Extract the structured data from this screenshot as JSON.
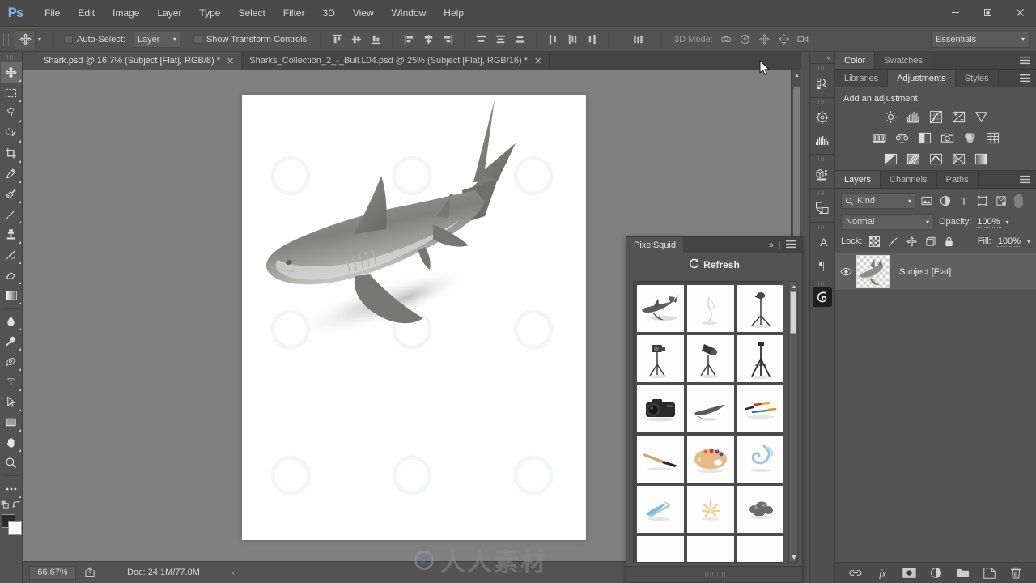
{
  "app": {
    "name": "Adobe Photoshop",
    "logo": "Ps",
    "logo_color": "#7fb3e8"
  },
  "titlebar": {
    "menus": [
      "File",
      "Edit",
      "Image",
      "Layer",
      "Type",
      "Select",
      "Filter",
      "3D",
      "View",
      "Window",
      "Help"
    ],
    "window_controls": [
      {
        "name": "minimize-button",
        "glyph": "—"
      },
      {
        "name": "maximize-button",
        "glyph": "❐"
      },
      {
        "name": "close-button",
        "glyph": "✕"
      }
    ]
  },
  "options_bar": {
    "tool_icon": "move-tool-icon",
    "auto_select_label": "Auto-Select:",
    "auto_select_checked": false,
    "auto_select_target": "Layer",
    "show_transform_label": "Show Transform Controls",
    "show_transform_checked": false,
    "align_icons": [
      "align-top-edges-icon",
      "align-vertical-centers-icon",
      "align-bottom-edges-icon",
      "align-left-edges-icon",
      "align-horizontal-centers-icon",
      "align-right-edges-icon"
    ],
    "distribute_icons": [
      "distribute-top-edges-icon",
      "distribute-vertical-centers-icon",
      "distribute-bottom-edges-icon",
      "distribute-left-edges-icon",
      "distribute-horizontal-centers-icon",
      "distribute-right-edges-icon"
    ],
    "auto_align_icon": "auto-align-layers-icon",
    "mode_3d_label": "3D Mode:",
    "mode_3d_icons": [
      "rotate-3d-object-icon",
      "roll-3d-object-icon",
      "drag-3d-object-icon",
      "slide-3d-object-icon",
      "scale-3d-object-icon"
    ],
    "workspace": "Essentials"
  },
  "document_tabs": [
    {
      "title": "Shark.psd @ 16.7% (Subject [Flat], RGB/8) *",
      "active": true
    },
    {
      "title": "Sharks_Collection_2_-_Bull.L04.psd @ 25% (Subject [Flat], RGB/16) *",
      "active": false
    }
  ],
  "toolbar": {
    "tools": [
      {
        "name": "move-tool",
        "glyph": "move",
        "active": true
      },
      {
        "name": "rectangular-marquee-tool",
        "glyph": "marquee",
        "active": false
      },
      {
        "name": "lasso-tool",
        "glyph": "lasso",
        "active": false
      },
      {
        "name": "quick-selection-tool",
        "glyph": "quickselect",
        "active": false
      },
      {
        "name": "crop-tool",
        "glyph": "crop",
        "active": false
      },
      {
        "name": "eyedropper-tool",
        "glyph": "eyedropper",
        "active": false
      },
      {
        "name": "spot-healing-brush-tool",
        "glyph": "healing",
        "active": false
      },
      {
        "name": "brush-tool",
        "glyph": "brush",
        "active": false
      },
      {
        "name": "clone-stamp-tool",
        "glyph": "stamp",
        "active": false
      },
      {
        "name": "history-brush-tool",
        "glyph": "historybrush",
        "active": false
      },
      {
        "name": "eraser-tool",
        "glyph": "eraser",
        "active": false
      },
      {
        "name": "gradient-tool",
        "glyph": "gradient",
        "active": false
      },
      {
        "name": "blur-tool",
        "glyph": "blur",
        "active": false
      },
      {
        "name": "dodge-tool",
        "glyph": "dodge",
        "active": false
      },
      {
        "name": "pen-tool",
        "glyph": "pen",
        "active": false
      },
      {
        "name": "horizontal-type-tool",
        "glyph": "type",
        "active": false
      },
      {
        "name": "path-selection-tool",
        "glyph": "pathselect",
        "active": false
      },
      {
        "name": "rectangle-tool",
        "glyph": "rectangle",
        "active": false
      },
      {
        "name": "hand-tool",
        "glyph": "hand",
        "active": false
      },
      {
        "name": "zoom-tool",
        "glyph": "zoom",
        "active": false
      },
      {
        "name": "edit-toolbar-tool",
        "glyph": "ellipsis",
        "active": false
      }
    ],
    "foreground_color": "#2b2b2b",
    "background_color": "#fcfcfc"
  },
  "canvas": {
    "document_name": "Shark.psd",
    "artwork": "bull-shark-3d-render",
    "background": "#808080",
    "page_background": "#fefefe"
  },
  "status_bar": {
    "zoom": "66.67%",
    "share_icon": "share-icon",
    "doc_info": "Doc: 24.1M/77.0M",
    "expand_glyph": "‹"
  },
  "icon_rail": {
    "collapse_glyph": "«",
    "groups": [
      {
        "icons": [
          "history-panel-icon"
        ]
      },
      {
        "icons": [
          "3d-panel-icon",
          "histogram-panel-icon"
        ]
      },
      {
        "icons": [
          "measurement-log-panel-icon"
        ]
      },
      {
        "icons": [
          "clone-source-panel-icon"
        ]
      },
      {
        "icons": [
          "character-panel-icon",
          "paragraph-panel-icon"
        ]
      },
      {
        "icons": [
          "pixelsquid-panel-icon"
        ]
      }
    ]
  },
  "color_panel": {
    "tabs": [
      {
        "label": "Color",
        "active": true
      },
      {
        "label": "Swatches",
        "active": false
      }
    ],
    "menu_icon": "panel-menu-icon"
  },
  "adjustments_panel": {
    "tabs": [
      {
        "label": "Libraries",
        "active": false
      },
      {
        "label": "Adjustments",
        "active": true
      },
      {
        "label": "Styles",
        "active": false
      }
    ],
    "menu_icon": "panel-menu-icon",
    "heading": "Add an adjustment",
    "rows": [
      [
        "brightness-contrast-icon",
        "levels-icon",
        "curves-icon",
        "exposure-icon",
        "vibrance-icon"
      ],
      [
        "hue-saturation-icon",
        "color-balance-icon",
        "black-and-white-icon",
        "photo-filter-icon",
        "channel-mixer-icon",
        "color-lookup-icon"
      ],
      [
        "invert-icon",
        "posterize-icon",
        "threshold-icon",
        "selective-color-icon",
        "gradient-map-icon"
      ]
    ]
  },
  "layers_panel": {
    "tabs": [
      {
        "label": "Layers",
        "active": true
      },
      {
        "label": "Channels",
        "active": false
      },
      {
        "label": "Paths",
        "active": false
      }
    ],
    "menu_icon": "panel-menu-icon",
    "filter": {
      "search_icon": "search-icon",
      "kind_label": "Kind",
      "type_filters": [
        "filter-pixel-layers-icon",
        "filter-adjustment-layers-icon",
        "filter-type-layers-icon",
        "filter-shape-layers-icon",
        "filter-smart-objects-icon"
      ],
      "toggle_name": "filter-enable-toggle"
    },
    "blend_mode": "Normal",
    "opacity_label": "Opacity:",
    "opacity_value": "100%",
    "lock_label": "Lock:",
    "lock_icons": [
      "lock-transparent-pixels-icon",
      "lock-image-pixels-icon",
      "lock-position-icon",
      "lock-artboard-nesting-icon",
      "lock-all-icon"
    ],
    "fill_label": "Fill:",
    "fill_value": "100%",
    "layers": [
      {
        "name": "Subject [Flat]",
        "visible": true,
        "selected": true,
        "thumbnail": "shark-thumbnail"
      }
    ],
    "footer_icons": [
      "link-layers-icon",
      "layer-style-fx-icon",
      "add-layer-mask-icon",
      "new-adjustment-layer-icon",
      "new-group-icon",
      "new-layer-icon",
      "delete-layer-icon"
    ]
  },
  "pixelsquid_panel": {
    "title": "PixelSquid",
    "expand_glyph": "»",
    "menu_icon": "panel-menu-icon",
    "refresh_label": "Refresh",
    "refresh_icon": "refresh-icon",
    "thumbnails": [
      {
        "name": "shark",
        "kind": "shark"
      },
      {
        "name": "shark-faint",
        "kind": "shark-faint"
      },
      {
        "name": "light-stand",
        "kind": "lightstand"
      },
      {
        "name": "camera-on-tripod",
        "kind": "camtripod"
      },
      {
        "name": "studio-light",
        "kind": "studiolight"
      },
      {
        "name": "tripod",
        "kind": "tripod"
      },
      {
        "name": "dslr-camera",
        "kind": "dslr"
      },
      {
        "name": "whale-shape",
        "kind": "whale"
      },
      {
        "name": "colored-pencils",
        "kind": "pencils"
      },
      {
        "name": "paintbrush",
        "kind": "paintbrush"
      },
      {
        "name": "paint-palette",
        "kind": "palette"
      },
      {
        "name": "water-splash",
        "kind": "splash"
      },
      {
        "name": "paint-stroke",
        "kind": "stroke"
      },
      {
        "name": "light-flare",
        "kind": "flare"
      },
      {
        "name": "rock-cluster",
        "kind": "rocks"
      },
      {
        "name": "item-16",
        "kind": "blank"
      },
      {
        "name": "item-17",
        "kind": "blank"
      },
      {
        "name": "item-18",
        "kind": "blank"
      }
    ]
  },
  "watermark": {
    "text": "人人素材",
    "mark": "M"
  }
}
